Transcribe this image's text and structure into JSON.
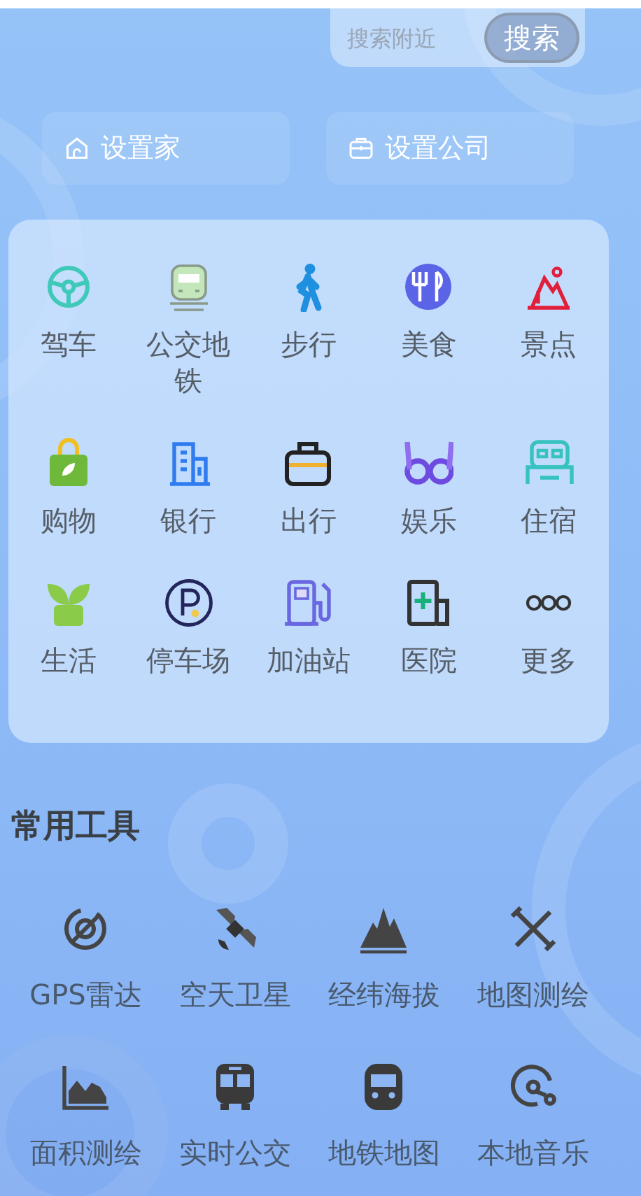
{
  "search": {
    "placeholder": "搜索附近",
    "button": "搜索"
  },
  "shortcuts": [
    {
      "label": "设置家"
    },
    {
      "label": "设置公司"
    }
  ],
  "categories": [
    {
      "label": "驾车"
    },
    {
      "label": "公交地铁"
    },
    {
      "label": "步行"
    },
    {
      "label": "美食"
    },
    {
      "label": "景点"
    },
    {
      "label": "购物"
    },
    {
      "label": "银行"
    },
    {
      "label": "出行"
    },
    {
      "label": "娱乐"
    },
    {
      "label": "住宿"
    },
    {
      "label": "生活"
    },
    {
      "label": "停车场"
    },
    {
      "label": "加油站"
    },
    {
      "label": "医院"
    },
    {
      "label": "更多"
    }
  ],
  "tools_section": {
    "title": "常用工具"
  },
  "tools": [
    {
      "label": "GPS雷达"
    },
    {
      "label": "空天卫星"
    },
    {
      "label": "经纬海拔"
    },
    {
      "label": "地图测绘"
    },
    {
      "label": "面积测绘"
    },
    {
      "label": "实时公交"
    },
    {
      "label": "地铁地图"
    },
    {
      "label": "本地音乐"
    }
  ]
}
